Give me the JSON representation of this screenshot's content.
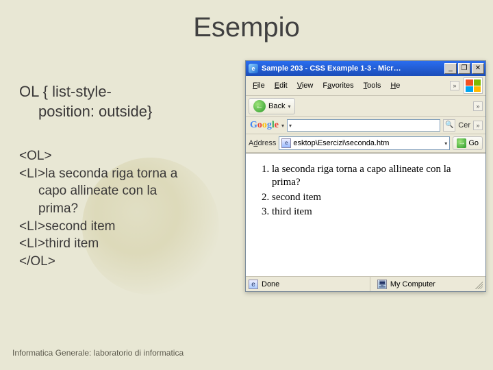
{
  "slide": {
    "title": "Esempio",
    "css_selector": "OL { list-style-",
    "css_rule_cont": "position: outside}",
    "code": {
      "l1": "<OL>",
      "l2a": "<LI>la seconda riga torna a",
      "l2b": "capo allineate con la",
      "l2c": "prima?",
      "l3": "<LI>second item",
      "l4": "<LI>third item",
      "l5": "</OL>"
    },
    "footer": "Informatica Generale: laboratorio di informatica"
  },
  "browser": {
    "title": "Sample 203 - CSS Example 1-3 - Micr…",
    "menu": {
      "file": "File",
      "edit": "Edit",
      "view": "View",
      "favorites": "Favorites",
      "tools": "Tools",
      "help": "He"
    },
    "toolbar": {
      "back": "Back"
    },
    "google": {
      "cer": "Cer"
    },
    "address": {
      "label": "Address",
      "path": "esktop\\Esercizi\\seconda.htm",
      "go": "Go"
    },
    "content": {
      "item1": "la seconda riga torna a capo allineate con la prima?",
      "item2": "second item",
      "item3": "third item"
    },
    "status": {
      "done": "Done",
      "zone": "My Computer"
    }
  }
}
